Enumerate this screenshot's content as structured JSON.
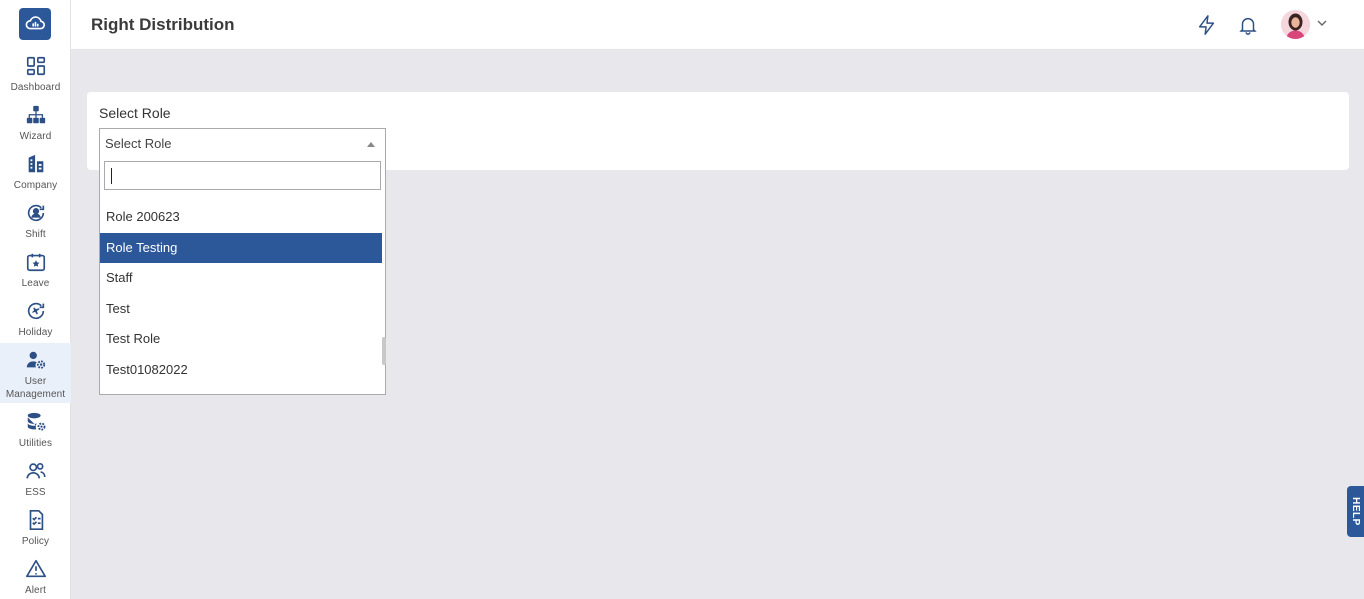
{
  "header": {
    "title": "Right Distribution"
  },
  "sidebar": {
    "items": [
      {
        "label": "Dashboard",
        "icon": "dashboard-icon"
      },
      {
        "label": "Wizard",
        "icon": "sitemap-icon"
      },
      {
        "label": "Company",
        "icon": "building-icon"
      },
      {
        "label": "Shift",
        "icon": "user-cycle-icon"
      },
      {
        "label": "Leave",
        "icon": "calendar-star-icon"
      },
      {
        "label": "Holiday",
        "icon": "holiday-icon"
      },
      {
        "label": "User Management",
        "icon": "user-gear-icon",
        "active": true
      },
      {
        "label": "Utilities",
        "icon": "database-gear-icon"
      },
      {
        "label": "ESS",
        "icon": "users-icon"
      },
      {
        "label": "Policy",
        "icon": "checklist-icon"
      },
      {
        "label": "Alert",
        "icon": "warning-icon"
      }
    ]
  },
  "form": {
    "label": "Select Role",
    "select_value": "Select Role",
    "search_value": ""
  },
  "dropdown": {
    "options": [
      {
        "label": "Role 200623"
      },
      {
        "label": "Role Testing",
        "selected": true
      },
      {
        "label": "Staff"
      },
      {
        "label": "Test"
      },
      {
        "label": "Test Role"
      },
      {
        "label": "Test01082022"
      }
    ]
  },
  "help": {
    "label": "HELP"
  },
  "colors": {
    "brand": "#2c5799",
    "background": "#e8e8ec",
    "selected": "#2c5799"
  }
}
